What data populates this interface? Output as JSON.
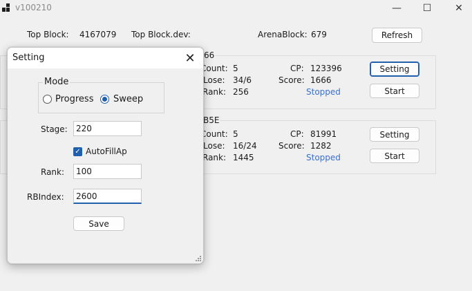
{
  "window": {
    "title": "v100210",
    "minimize_glyph": "—",
    "maximize_glyph": "☐",
    "close_glyph": "✕"
  },
  "top_bar": {
    "top_block_label": "Top Block:",
    "top_block_value": "4167079",
    "top_block_dev_label": "Top Block.dev:",
    "arena_block_label": "ArenaBlock:",
    "arena_block_value": "679",
    "refresh_label": "Refresh"
  },
  "accounts": [
    {
      "id_suffix": "66",
      "count_label": "Count:",
      "count_value": "5",
      "winlose_label": "/Lose:",
      "winlose_value": "34/6",
      "rank_label": "Rank:",
      "rank_value": "256",
      "cp_label": "CP:",
      "cp_value": "123396",
      "score_label": "Score:",
      "score_value": "1666",
      "status": "Stopped",
      "setting_label": "Setting",
      "start_label": "Start"
    },
    {
      "id_suffix": "B5E",
      "count_label": "Count:",
      "count_value": "5",
      "winlose_label": "/Lose:",
      "winlose_value": "16/24",
      "rank_label": "Rank:",
      "rank_value": "1445",
      "cp_label": "CP:",
      "cp_value": "81991",
      "score_label": "Score:",
      "score_value": "1282",
      "status": "Stopped",
      "setting_label": "Setting",
      "start_label": "Start"
    }
  ],
  "dialog": {
    "title": "Setting",
    "close_glyph": "✕",
    "mode_legend": "Mode",
    "mode_options": [
      {
        "label": "Progress",
        "checked": false
      },
      {
        "label": "Sweep",
        "checked": true
      }
    ],
    "stage_label": "Stage:",
    "stage_value": "220",
    "autofill_label": "AutoFillAp",
    "autofill_checked": true,
    "rank_label": "Rank:",
    "rank_value": "100",
    "rbindex_label": "RBIndex:",
    "rbindex_value": "2600",
    "save_label": "Save"
  },
  "colors": {
    "accent": "#1f5fae",
    "status_stopped": "#3a6fd0",
    "window_bg": "#f0f0f0"
  }
}
